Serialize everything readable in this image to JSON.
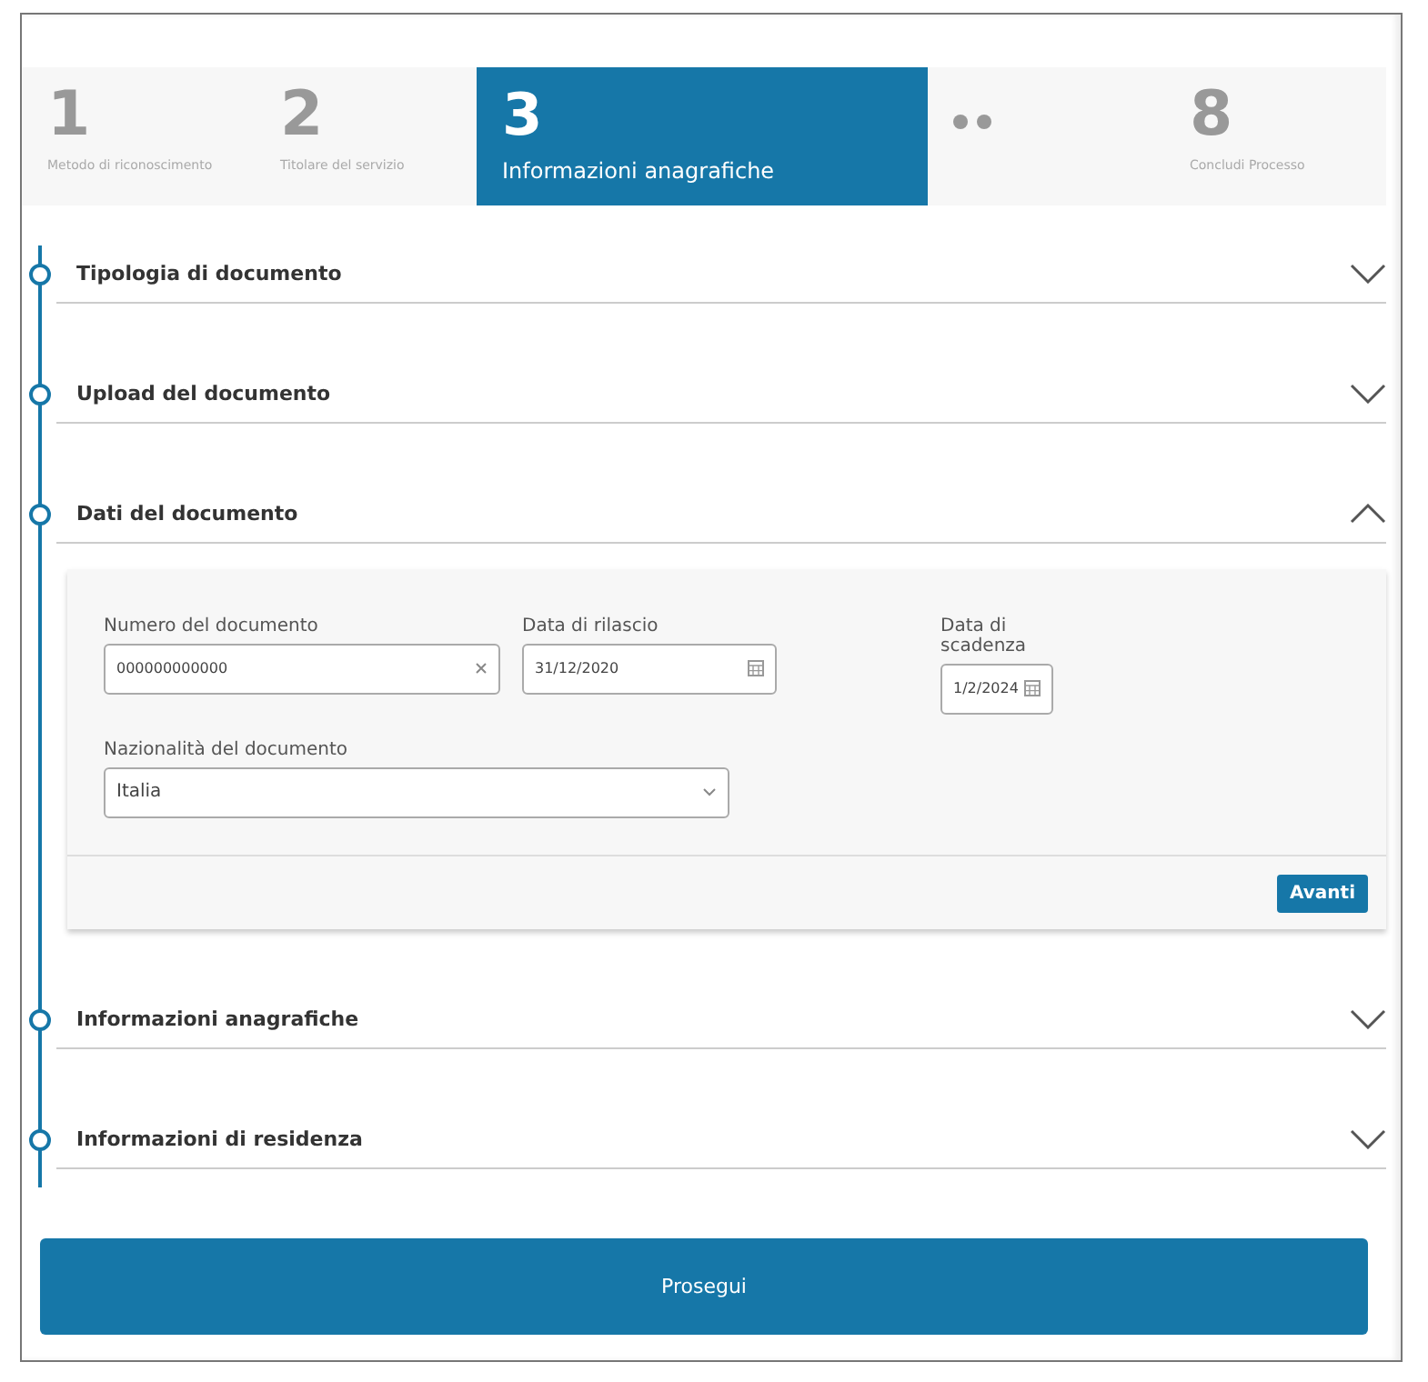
{
  "steps": [
    {
      "kind": "step",
      "number": "1",
      "label": "Metodo di riconoscimento",
      "selected": false
    },
    {
      "kind": "step",
      "number": "2",
      "label": "Titolare del servizio",
      "selected": false
    },
    {
      "kind": "step",
      "number": "3",
      "label": "Informazioni anagrafiche",
      "selected": true
    },
    {
      "kind": "ellipsis"
    },
    {
      "kind": "step",
      "number": "8",
      "label": "Concludi Processo",
      "selected": false
    }
  ],
  "sections": [
    {
      "title": "Tipologia di documento",
      "expanded": false
    },
    {
      "title": "Upload del documento",
      "expanded": false
    },
    {
      "title": "Dati del documento",
      "expanded": true,
      "fields": [
        {
          "kind": "text",
          "label": "Numero del documento",
          "value": "000000000000"
        },
        {
          "kind": "date",
          "label": "Data di rilascio",
          "value": "31/12/2020"
        },
        {
          "kind": "date",
          "label": "Data di scadenza",
          "value": "1/2/2024"
        },
        {
          "kind": "select",
          "label": "Nazionalità del documento",
          "value": "Italia"
        }
      ],
      "button": "Avanti"
    },
    {
      "title": "Informazioni anagrafiche",
      "expanded": false
    },
    {
      "title": "Informazioni di residenza",
      "expanded": false
    }
  ],
  "submit": "Prosegui"
}
